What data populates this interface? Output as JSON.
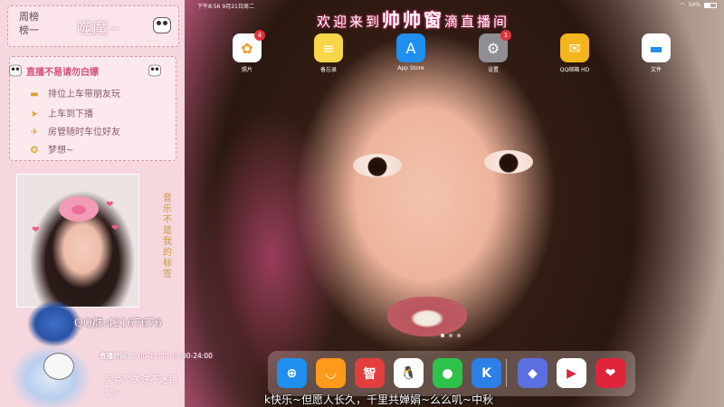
{
  "status_bar": {
    "time": "下午8:56",
    "date": "9月21日周二",
    "battery": "50%",
    "battery_level": 0.5
  },
  "banner": {
    "prefix": "欢迎来到",
    "name": "帅帅窗",
    "suffix": "滴直播间"
  },
  "apps": [
    {
      "label": "照片",
      "icon": "photos-icon",
      "badge": "4",
      "bg": "#ffffff"
    },
    {
      "label": "备忘录",
      "icon": "notes-icon",
      "badge": "",
      "bg": "#f7d64a"
    },
    {
      "label": "App Store",
      "icon": "app-store-icon",
      "badge": "",
      "bg": "#1f8ff0"
    },
    {
      "label": "设置",
      "icon": "settings-icon",
      "badge": "1",
      "bg": "#8e8e93"
    },
    {
      "label": "QQ邮箱 HD",
      "icon": "qq-mail-icon",
      "badge": "",
      "bg": "#f3b51d"
    },
    {
      "label": "文件",
      "icon": "files-icon",
      "badge": "",
      "bg": "#ffffff"
    }
  ],
  "dock": [
    {
      "name": "safari-icon",
      "glyph": "⊕",
      "bg": "#1f8ff0"
    },
    {
      "name": "smile-app-icon",
      "glyph": "◡",
      "bg": "#ff9a1a"
    },
    {
      "name": "zhihui-app-icon",
      "glyph": "智",
      "bg": "#e43d3d"
    },
    {
      "name": "qq-icon",
      "glyph": "🐧",
      "bg": "#ffffff"
    },
    {
      "name": "wechat-icon",
      "glyph": "●",
      "bg": "#2ec24a"
    },
    {
      "name": "k-app-icon",
      "glyph": "K",
      "bg": "#2b7fe6"
    },
    {
      "name": "game-app-icon",
      "glyph": "◆",
      "bg": "#5a6fe0"
    },
    {
      "name": "youku-icon",
      "glyph": "▶",
      "bg": "#ffffff"
    },
    {
      "name": "heart-app-icon",
      "glyph": "❤",
      "bg": "#e0243a"
    }
  ],
  "ticker": "k快乐~但愿人长久，千里共婵娟~么么叽~中秋",
  "panel": {
    "weekly_title": "周榜",
    "weekly_title_2": "榜一",
    "weekly_name": "噬魔~",
    "rules_header": "直播不易请勿白嫖",
    "rules": [
      {
        "mark": "▬",
        "text": "排位上车带朋友玩"
      },
      {
        "mark": "➤",
        "text": "上车到下播"
      },
      {
        "mark": "✈",
        "text": "房管随时车位好友"
      },
      {
        "mark": "✪",
        "text": "梦想~"
      }
    ],
    "vertical_text": "音乐不是我的标签",
    "qq_label": "QQ群:",
    "qq_number": "42167676",
    "hours_label": "直播时间:",
    "hours_value": "2:00-11:30   19:00-24:00",
    "slogan": "宝点个关注不迷路呦~"
  }
}
